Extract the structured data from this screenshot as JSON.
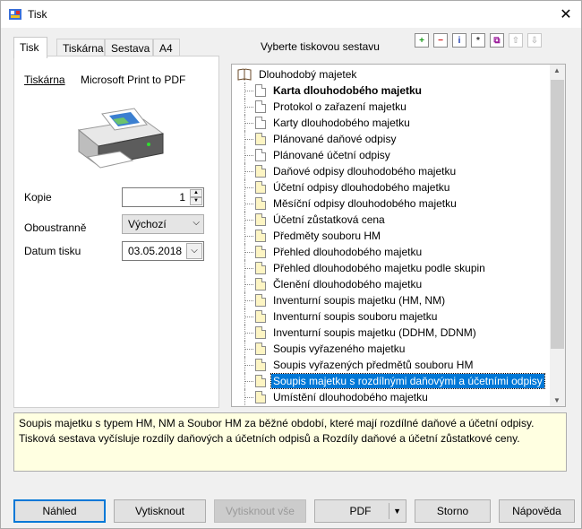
{
  "window": {
    "title": "Tisk",
    "close_glyph": "✕"
  },
  "tabs": [
    {
      "label": "Tisk",
      "active": true
    },
    {
      "label": "Tiskárna",
      "active": false
    },
    {
      "label": "Sestava",
      "active": false
    },
    {
      "label": "A4",
      "active": false
    }
  ],
  "printer": {
    "label": "Tiskárna",
    "name": "Microsoft Print to PDF"
  },
  "form": {
    "copies_label": "Kopie",
    "copies_value": "1",
    "duplex_label": "Oboustranně",
    "duplex_value": "Výchozí",
    "date_label": "Datum tisku",
    "date_value": "03.05.2018"
  },
  "report_section": {
    "title": "Vyberte tiskovou sestavu",
    "toolbar": [
      {
        "icon": "add-icon",
        "glyph": "+"
      },
      {
        "icon": "remove-icon",
        "glyph": "−"
      },
      {
        "icon": "info-icon",
        "glyph": "i"
      },
      {
        "icon": "asterisk-icon",
        "glyph": "*"
      },
      {
        "icon": "copy-icon",
        "glyph": "⧉"
      },
      {
        "icon": "move-up-icon",
        "glyph": "⇧"
      },
      {
        "icon": "move-down-icon",
        "glyph": "⇩"
      }
    ]
  },
  "tree": {
    "root": "Dlouhodobý majetek",
    "items": [
      {
        "label": "Karta dlouhodobého majetku",
        "bold": true,
        "white": true
      },
      {
        "label": "Protokol o zařazení majetku",
        "white": true
      },
      {
        "label": "Karty dlouhodobého majetku",
        "white": true
      },
      {
        "label": "Plánované daňové odpisy"
      },
      {
        "label": "Plánované účetní odpisy",
        "white": true
      },
      {
        "label": "Daňové odpisy dlouhodobého majetku"
      },
      {
        "label": "Účetní odpisy dlouhodobého majetku"
      },
      {
        "label": "Měsíční odpisy dlouhodobého majetku"
      },
      {
        "label": "Účetní zůstatková cena"
      },
      {
        "label": "Předměty souboru HM"
      },
      {
        "label": "Přehled dlouhodobého majetku"
      },
      {
        "label": "Přehled dlouhodobého majetku podle skupin"
      },
      {
        "label": "Členění dlouhodobého majetku"
      },
      {
        "label": "Inventurní soupis majetku (HM, NM)"
      },
      {
        "label": "Inventurní soupis souboru majetku"
      },
      {
        "label": "Inventurní soupis majetku (DDHM, DDNM)"
      },
      {
        "label": "Soupis vyřazeného majetku"
      },
      {
        "label": "Soupis vyřazených předmětů souboru HM"
      },
      {
        "label": "Soupis majetku s rozdílnými daňovými a účetními odpisy",
        "selected": true
      },
      {
        "label": "Umístění dlouhodobého majetku"
      }
    ]
  },
  "description": {
    "line1": "Soupis majetku s typem HM, NM a Soubor HM za běžné období, které mají rozdílné daňové a účetní odpisy.",
    "line2": "Tisková sestava vyčísluje rozdíly daňových a účetních odpisů a Rozdíly daňové a účetní zůstatkové ceny."
  },
  "buttons": {
    "preview": "Náhled",
    "print": "Vytisknout",
    "print_all": "Vytisknout vše",
    "pdf": "PDF",
    "cancel": "Storno",
    "help": "Nápověda"
  }
}
